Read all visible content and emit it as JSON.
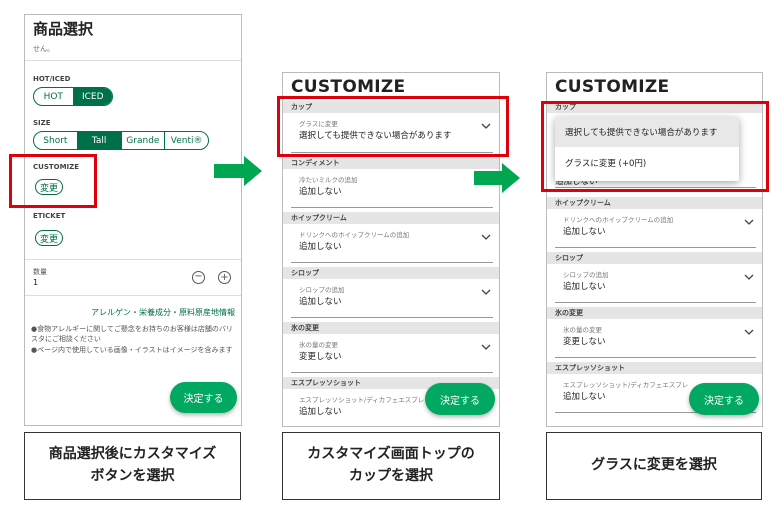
{
  "p1": {
    "title": "商品選択",
    "top_text": "せん。",
    "hot_iced_label": "HOT/ICED",
    "hot": "HOT",
    "iced": "ICED",
    "size_label": "SIZE",
    "sizes": [
      "Short",
      "Tall",
      "Grande",
      "Venti®"
    ],
    "customize_label": "CUSTOMIZE",
    "customize_btn": "変更",
    "eticket_label": "ETICKET",
    "eticket_btn": "変更",
    "qty_label": "数量",
    "qty_value": "1",
    "minus": "−",
    "plus": "+",
    "allergen_link": "アレルゲン・栄養成分・原料原産地情報",
    "note1": "●食物アレルギーに関してご懸念をお持ちのお客様は店舗のバリスタにご相談ください",
    "note2": "●ページ内で使用している画像・イラストはイメージを含みます",
    "decide": "決定する"
  },
  "p2": {
    "title": "CUSTOMIZE",
    "cup_head": "カップ",
    "glass_label": "グラスに変更",
    "glass_value": "選択しても提供できない場合があります",
    "condiment_head": "コンディメント",
    "milk_label": "冷たいミルクの追加",
    "milk_value": "追加しない",
    "whip_head": "ホイップクリーム",
    "whip_label": "ドリンクへのホイップクリームの追加",
    "whip_value": "追加しない",
    "syrup_head": "シロップ",
    "syrup_label": "シロップの追加",
    "syrup_value": "追加しない",
    "ice_head": "氷の変更",
    "ice_label": "氷の量の変更",
    "ice_value": "変更しない",
    "espresso_head": "エスプレッソショット",
    "espresso_label": "エスプレッソショット/ディカフェエスプレ",
    "espresso_value": "追加しない",
    "decide": "決定する"
  },
  "p3": {
    "title": "CUSTOMIZE",
    "cup_head": "カップ",
    "opt1": "選択しても提供できない場合があります",
    "opt2": "グラスに変更 (+0円)",
    "milk_value": "追加しない",
    "whip_head": "ホイップクリーム",
    "whip_label": "ドリンクへのホイップクリームの追加",
    "whip_value": "追加しない",
    "syrup_head": "シロップ",
    "syrup_label": "シロップの追加",
    "syrup_value": "追加しない",
    "ice_head": "氷の変更",
    "ice_label": "氷の量の変更",
    "ice_value": "変更しない",
    "espresso_head": "エスプレッソショット",
    "espresso_label": "エスプレッソショット/ディカフェエスプレ",
    "espresso_value": "追加しない",
    "decide": "決定する"
  },
  "captions": {
    "c1": "商品選択後にカスタマイズボタンを選択",
    "c2": "カスタマイズ画面トップのカップを選択",
    "c3": "グラスに変更を選択"
  },
  "colors": {
    "accent": "#00704a",
    "button": "#00a862",
    "highlight": "#e0000b",
    "arrow": "#00a650"
  }
}
